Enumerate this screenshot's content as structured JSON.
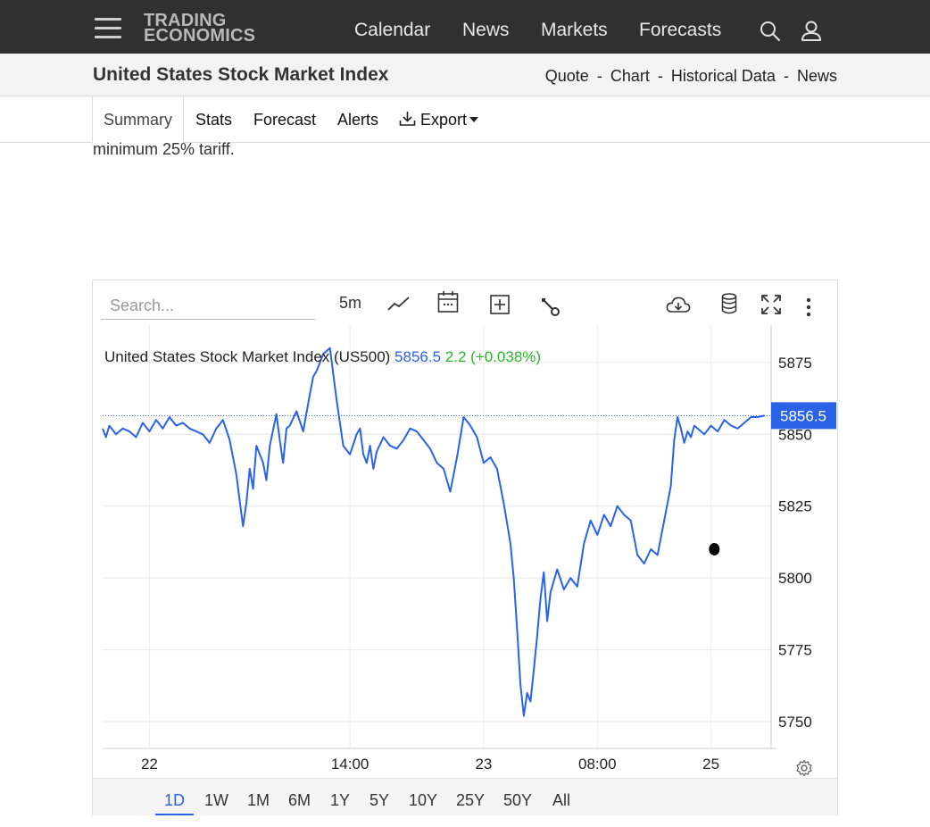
{
  "header": {
    "logo_line1": "TRADING",
    "logo_line2": "ECONOMICS",
    "nav": [
      "Calendar",
      "News",
      "Markets",
      "Forecasts"
    ],
    "icons": [
      "menu-icon",
      "search-icon",
      "user-icon"
    ]
  },
  "titlebar": {
    "title": "United States Stock Market Index",
    "links": [
      "Quote",
      "Chart",
      "Historical Data",
      "News"
    ],
    "separator": "-"
  },
  "tabs": {
    "summary": "Summary",
    "stats": "Stats",
    "forecast": "Forecast",
    "alerts": "Alerts",
    "export": "Export"
  },
  "article": {
    "fragment": "minimum 25% tariff."
  },
  "widget": {
    "search_placeholder": "Search...",
    "interval": "5m",
    "tool_icons": [
      "line-chart-icon",
      "calendar-icon",
      "plus-box-icon",
      "wrench-icon",
      "cloud-download-icon",
      "database-icon",
      "fullscreen-icon",
      "more-vertical-icon",
      "settings-gear-icon"
    ],
    "ranges": [
      "1D",
      "1W",
      "1M",
      "6M",
      "1Y",
      "5Y",
      "10Y",
      "25Y",
      "50Y",
      "All"
    ],
    "active_range": "1D"
  },
  "chart_data": {
    "type": "line",
    "series_label": "United States Stock Market Index (US500)",
    "last_value": "5856.5",
    "change": "2.2",
    "change_pct": "(+0.038%)",
    "price_tag": "5856.5",
    "y_ticks": [
      5875,
      5850,
      5825,
      5800,
      5775,
      5750
    ],
    "y_tick_labels": [
      "5875",
      "5850",
      "5825",
      "5800",
      "5775",
      "5750"
    ],
    "ylim": [
      5741,
      5888
    ],
    "x_ticks": [
      "22",
      "14:00",
      "23",
      "08:00",
      "25"
    ],
    "x_tick_positions": [
      0.07,
      0.37,
      0.57,
      0.74,
      0.91
    ],
    "grid": true,
    "colors": {
      "line": "#2a62e8",
      "up": "#2bb52b",
      "tag_bg": "#2a62e8"
    },
    "x": [
      0,
      0.005,
      0.01,
      0.02,
      0.03,
      0.04,
      0.05,
      0.06,
      0.07,
      0.08,
      0.09,
      0.1,
      0.11,
      0.12,
      0.13,
      0.14,
      0.15,
      0.16,
      0.17,
      0.18,
      0.19,
      0.2,
      0.205,
      0.21,
      0.215,
      0.22,
      0.225,
      0.23,
      0.24,
      0.245,
      0.25,
      0.26,
      0.265,
      0.27,
      0.275,
      0.28,
      0.29,
      0.3,
      0.31,
      0.315,
      0.32,
      0.33,
      0.34,
      0.35,
      0.36,
      0.37,
      0.38,
      0.385,
      0.39,
      0.395,
      0.4,
      0.405,
      0.41,
      0.42,
      0.43,
      0.44,
      0.45,
      0.46,
      0.47,
      0.48,
      0.49,
      0.5,
      0.51,
      0.52,
      0.53,
      0.54,
      0.55,
      0.56,
      0.57,
      0.58,
      0.59,
      0.6,
      0.61,
      0.615,
      0.62,
      0.625,
      0.63,
      0.635,
      0.64,
      0.645,
      0.65,
      0.655,
      0.66,
      0.665,
      0.67,
      0.68,
      0.69,
      0.7,
      0.71,
      0.72,
      0.73,
      0.74,
      0.75,
      0.76,
      0.77,
      0.78,
      0.79,
      0.8,
      0.81,
      0.82,
      0.83,
      0.84,
      0.85,
      0.855,
      0.86,
      0.865,
      0.87,
      0.875,
      0.88,
      0.885,
      0.89,
      0.9,
      0.91,
      0.92,
      0.93,
      0.94,
      0.95,
      0.96,
      0.97,
      0.98,
      0.99,
      1.0
    ],
    "values": [
      5852,
      5849,
      5853,
      5850,
      5852,
      5851,
      5849,
      5854,
      5851,
      5855,
      5852,
      5856,
      5853,
      5854,
      5852,
      5851,
      5850,
      5847,
      5852,
      5855,
      5848,
      5836,
      5827,
      5818,
      5826,
      5838,
      5831,
      5846,
      5840,
      5834,
      5846,
      5857,
      5848,
      5840,
      5852,
      5853,
      5858,
      5851,
      5864,
      5870,
      5872,
      5878,
      5880,
      5862,
      5846,
      5843,
      5850,
      5852,
      5843,
      5840,
      5846,
      5838,
      5844,
      5849,
      5846,
      5845,
      5848,
      5852,
      5851,
      5848,
      5845,
      5840,
      5838,
      5830,
      5842,
      5856,
      5853,
      5849,
      5840,
      5842,
      5838,
      5826,
      5812,
      5800,
      5782,
      5763,
      5752,
      5760,
      5757,
      5768,
      5780,
      5793,
      5802,
      5785,
      5795,
      5803,
      5796,
      5800,
      5797,
      5812,
      5820,
      5815,
      5822,
      5818,
      5825,
      5822,
      5820,
      5808,
      5805,
      5810,
      5808,
      5820,
      5832,
      5848,
      5856,
      5852,
      5847,
      5851,
      5849,
      5853,
      5852,
      5850,
      5853,
      5851,
      5855,
      5853,
      5852,
      5854,
      5856,
      5856,
      5856.5
    ],
    "marker_value": 5810,
    "marker_x": 0.915
  }
}
